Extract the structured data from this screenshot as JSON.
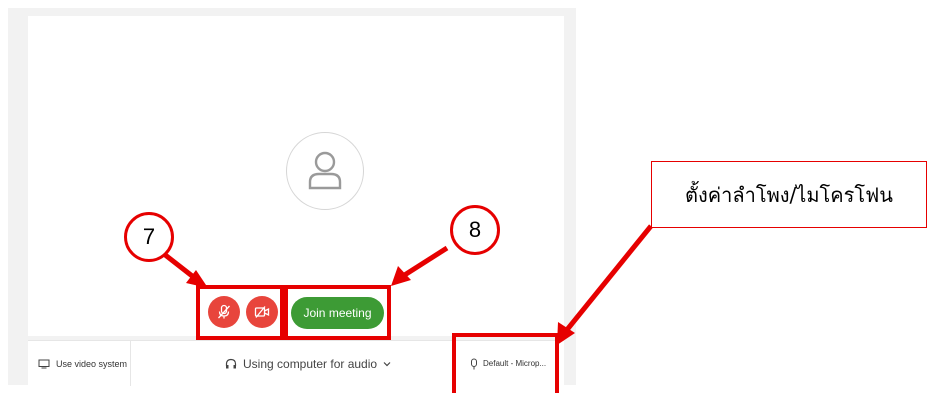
{
  "join_button": {
    "label": "Join meeting"
  },
  "bottom_bar": {
    "video_system_label": "Use video system",
    "audio_label": "Using computer for audio",
    "mic_label": "Default - Microp..."
  },
  "annotations": {
    "step_7": "7",
    "step_8": "8",
    "speaker_mic_settings": "ตั้งค่าลำโพง/ไมโครโฟน"
  },
  "icons": [
    "person-icon",
    "mic-muted-icon",
    "video-off-icon",
    "screen-icon",
    "headphones-icon",
    "chevron-down-icon",
    "microphone-icon"
  ],
  "colors": {
    "control_red": "#e8453c",
    "join_green": "#3d9b35",
    "annotation_red": "#e60000"
  }
}
